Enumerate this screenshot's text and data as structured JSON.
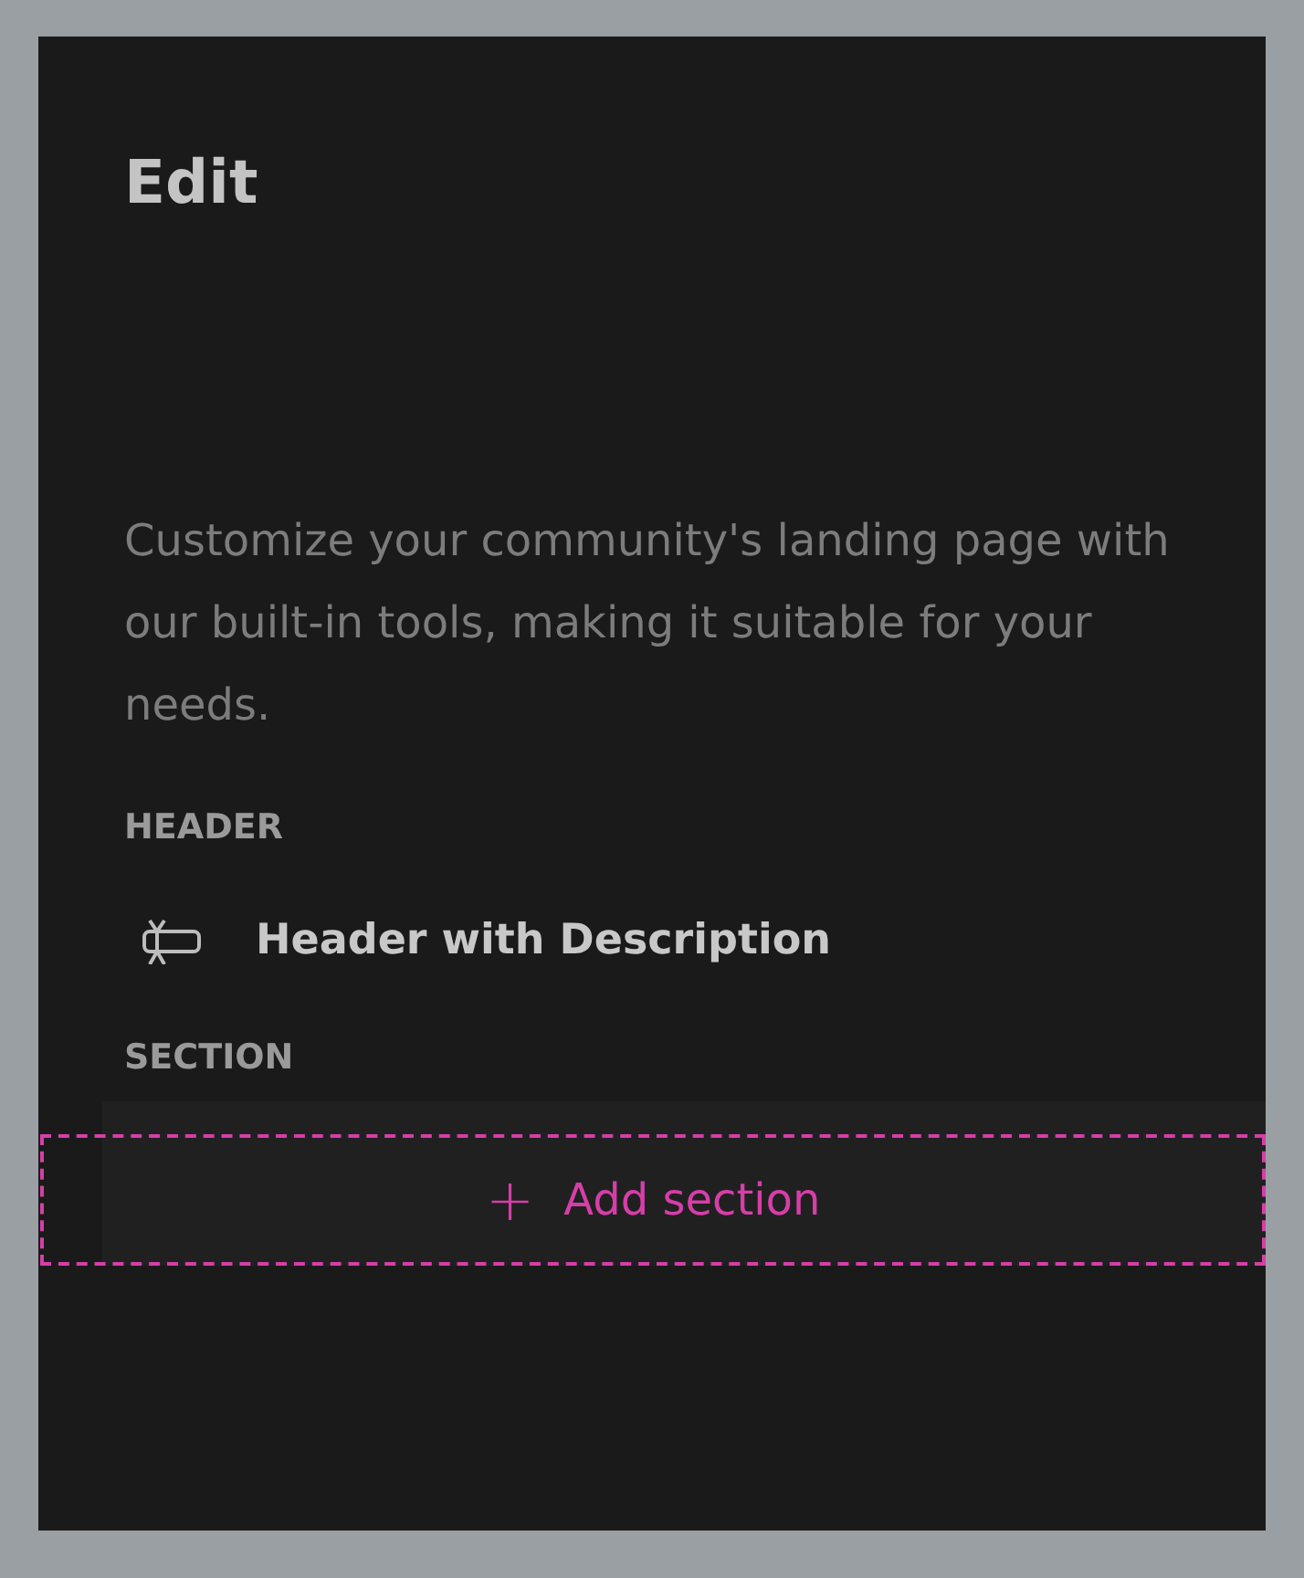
{
  "panel": {
    "title": "Edit",
    "description": "Customize your community's landing page with our built-in tools, making it suitable for your needs.",
    "groups": [
      {
        "label": "HEADER",
        "items": [
          {
            "label": "Header with Description"
          }
        ]
      },
      {
        "label": "SECTION"
      }
    ],
    "add_button": {
      "icon": "+",
      "label": "Add section"
    }
  }
}
